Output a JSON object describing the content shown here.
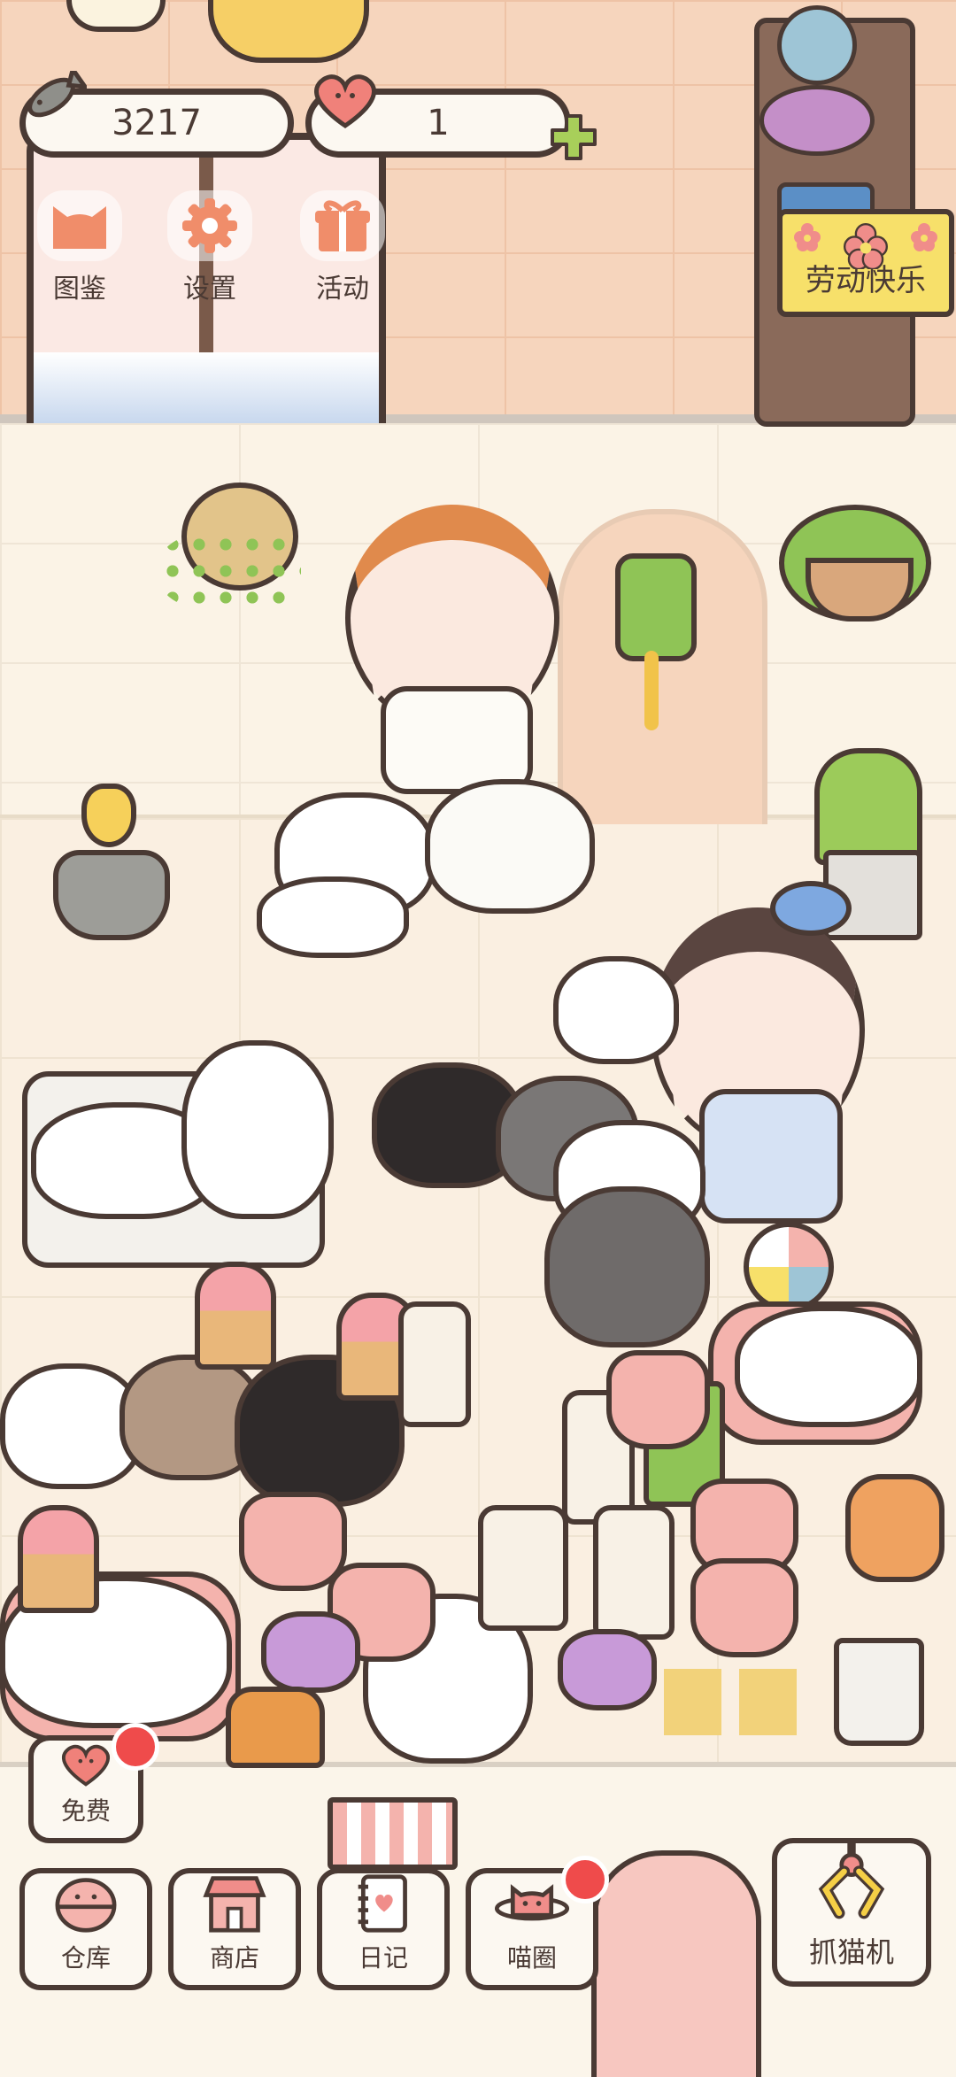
{
  "hud": {
    "fish_count": "3217",
    "heart_count": "1",
    "icons": {
      "fish": "fish-icon",
      "heart": "heart-icon",
      "plus": "plus-icon"
    }
  },
  "top_menu": [
    {
      "label": "图鉴",
      "icon": "cat-face-icon"
    },
    {
      "label": "设置",
      "icon": "gear-icon"
    },
    {
      "label": "活动",
      "icon": "gift-icon"
    }
  ],
  "event_banner": {
    "label": "劳动快乐",
    "icon": "flower-icon"
  },
  "free_button": {
    "label": "免费",
    "icon": "heart-icon"
  },
  "bottom_nav": [
    {
      "label": "仓库",
      "icon": "storage-icon"
    },
    {
      "label": "商店",
      "icon": "shop-icon"
    },
    {
      "label": "日记",
      "icon": "diary-icon"
    },
    {
      "label": "喵圈",
      "icon": "planet-cat-icon"
    }
  ],
  "claw_button": {
    "label": "抓猫机",
    "icon": "claw-icon"
  },
  "colors": {
    "outline": "#4a3a34",
    "badge": "#ef4b4b",
    "plus": "#a8cf5a",
    "heart": "#f0817a",
    "orange": "#f08d6a"
  }
}
